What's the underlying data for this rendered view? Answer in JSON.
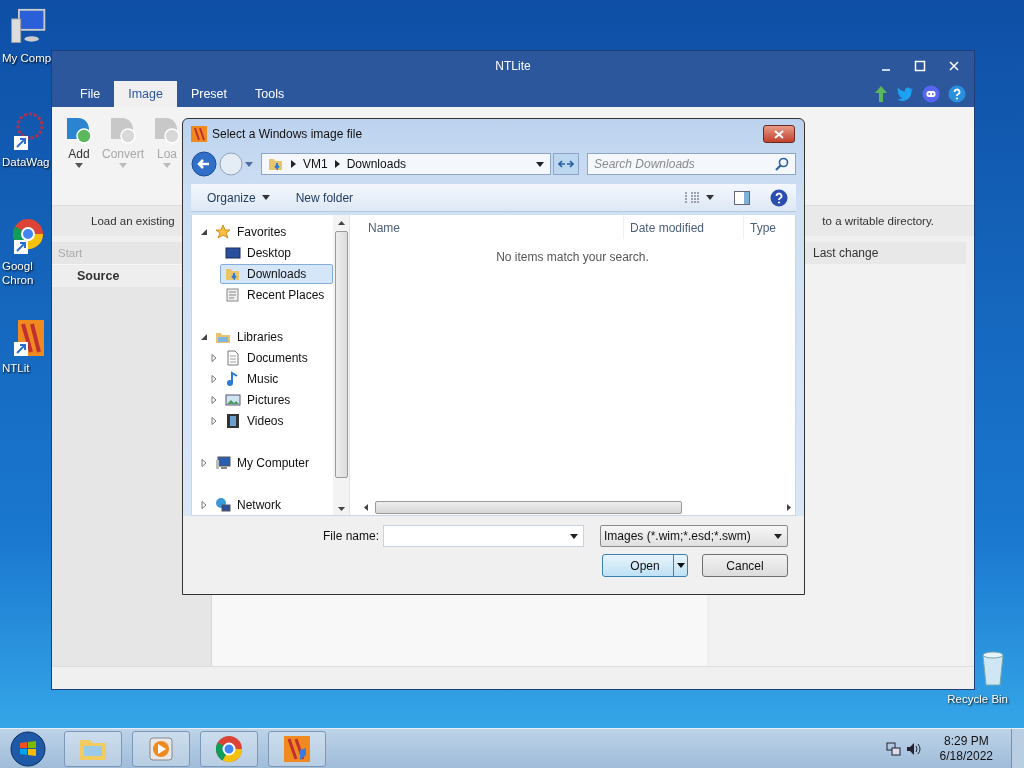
{
  "desktop_icons": [
    {
      "kind": "computer",
      "lines": [
        "My Comp"
      ]
    },
    {
      "kind": "molecule",
      "lines": [
        "DataWag"
      ]
    },
    {
      "kind": "chrome",
      "lines": [
        "Googl",
        "Chron"
      ]
    },
    {
      "kind": "ntlite",
      "lines": [
        "NTLit"
      ]
    },
    {
      "kind": "recycle",
      "lines": [
        "Recycle Bin"
      ]
    }
  ],
  "app_window": {
    "title": "NTLite",
    "tabs": [
      {
        "label": "File",
        "selected": false
      },
      {
        "label": "Image",
        "selected": true
      },
      {
        "label": "Preset",
        "selected": false
      },
      {
        "label": "Tools",
        "selected": false
      }
    ],
    "ribbon_buttons": [
      {
        "label": "Add",
        "disabled": false
      },
      {
        "label": "Convert",
        "disabled": true
      },
      {
        "label": "Loa",
        "disabled": true
      }
    ],
    "notice_start": "Load an existing",
    "notice_end": "to a writable directory.",
    "left_header": "Start",
    "left_row": "Source",
    "right_header": "Last change"
  },
  "dialog": {
    "title": "Select a Windows image file",
    "breadcrumb": [
      "VM1",
      "Downloads"
    ],
    "search": {
      "placeholder": "Search Downloads"
    },
    "toolbar": [
      "Organize",
      "New folder"
    ],
    "nav": [
      {
        "label": "Favorites",
        "kind": "star",
        "selected": false,
        "expanded": true,
        "children": [
          {
            "label": "Desktop",
            "kind": "desktop",
            "selected": false
          },
          {
            "label": "Downloads",
            "kind": "downloads",
            "selected": true
          },
          {
            "label": "Recent Places",
            "kind": "recent",
            "selected": false
          }
        ]
      },
      {
        "label": "Libraries",
        "kind": "library",
        "selected": false,
        "expanded": true,
        "children": [
          {
            "label": "Documents",
            "kind": "document",
            "selected": false,
            "expanded": false
          },
          {
            "label": "Music",
            "kind": "music",
            "selected": false,
            "expanded": false
          },
          {
            "label": "Pictures",
            "kind": "pictures",
            "selected": false,
            "expanded": false
          },
          {
            "label": "Videos",
            "kind": "videos",
            "selected": false,
            "expanded": false
          }
        ]
      },
      {
        "label": "My Computer",
        "kind": "computer",
        "selected": false,
        "expanded": false
      },
      {
        "label": "Network",
        "kind": "network",
        "selected": false,
        "expanded": false
      }
    ],
    "columns": [
      "Name",
      "Date modified",
      "Type"
    ],
    "empty_message": "No items match your search.",
    "file_name_label": "File name:",
    "file_type": "Images (*.wim;*.esd;*.swm)",
    "buttons": [
      {
        "label": "Open",
        "kind": "split"
      },
      {
        "label": "Cancel",
        "kind": "plain"
      }
    ]
  },
  "taskbar": {
    "apps": [
      {
        "kind": "explorer"
      },
      {
        "kind": "media"
      },
      {
        "kind": "chrome"
      },
      {
        "kind": "ntlite"
      }
    ],
    "time": "8:29 PM",
    "date": "6/18/2022"
  }
}
